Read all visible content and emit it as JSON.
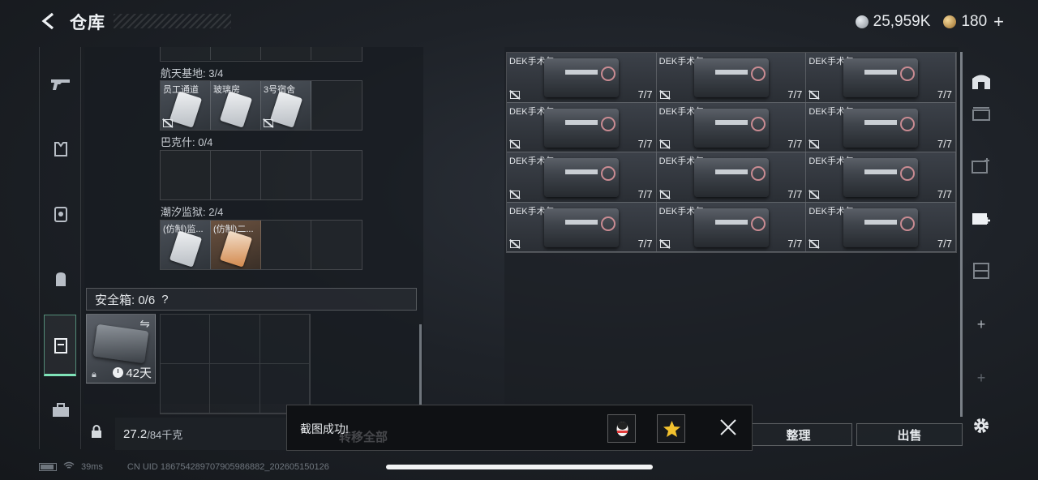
{
  "header": {
    "title": "仓库"
  },
  "currency": {
    "silver": "25,959K",
    "gold": "180",
    "plus": "+"
  },
  "left_nav": {
    "items": [
      {
        "icon": "gun-icon"
      },
      {
        "icon": "armor-vest-icon"
      },
      {
        "icon": "rig-icon"
      },
      {
        "icon": "backpack-icon"
      },
      {
        "icon": "safebox-icon",
        "active": true
      },
      {
        "icon": "briefcase-icon"
      }
    ]
  },
  "key_sections": [
    {
      "label": "航天基地: 3/4",
      "cards": [
        "员工通道",
        "玻璃房",
        "3号宿舍"
      ]
    },
    {
      "label": "巴克什: 0/4",
      "cards": []
    },
    {
      "label": "潮汐监狱: 2/4",
      "cards": [
        "(仿制)监...",
        "(仿制)二..."
      ]
    }
  ],
  "safebox": {
    "label": "安全箱: 0/6",
    "help": "?",
    "timer": "42天"
  },
  "weight": {
    "value": "27.2",
    "unit": "/84千克"
  },
  "inventory": {
    "item_name": "DEK手术包",
    "count": "7/7",
    "cells": 12
  },
  "buttons": {
    "organize": "整理",
    "sell": "出售"
  },
  "toast": {
    "message": "截图成功!",
    "behind_text": "转移全部"
  },
  "status": {
    "ping": "39ms",
    "uid": "CN UID 18675428970790598688​2_202605150126"
  },
  "colors": {
    "accent": "#7fe3b8",
    "panel": "#1e2228"
  }
}
